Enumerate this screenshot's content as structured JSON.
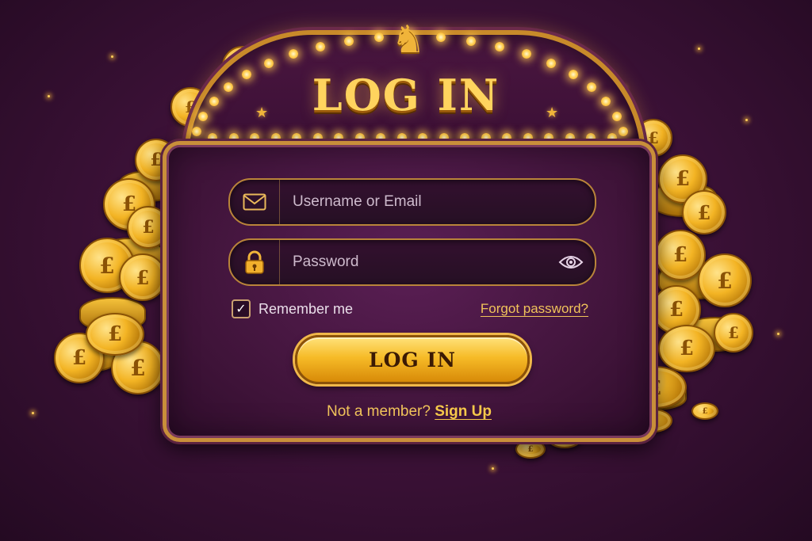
{
  "header": {
    "title": "LOG IN"
  },
  "form": {
    "username": {
      "placeholder": "Username or Email",
      "value": ""
    },
    "password": {
      "placeholder": "Password",
      "value": ""
    },
    "remember_label": "Remember me",
    "remember_checked": true,
    "forgot_label": "Forgot password?",
    "submit_label": "LOG IN",
    "signup_prompt": "Not a member?",
    "signup_label": "Sign Up"
  },
  "icons": {
    "username": "mail-icon",
    "password": "lock-icon",
    "show_password": "eye-icon",
    "mascot": "horse-head-icon",
    "remember_check": "checkmark-icon"
  },
  "colors": {
    "background": "#3e1239",
    "gold": "#f6bb27",
    "frame": "#c98f3a",
    "accent_text": "#f0c35a"
  }
}
